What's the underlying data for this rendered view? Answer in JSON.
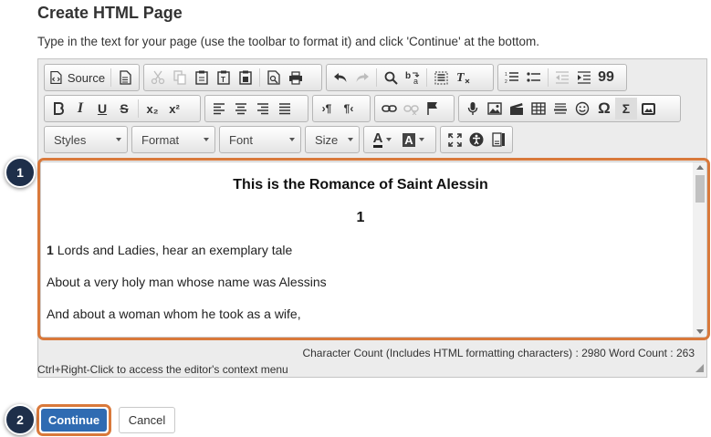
{
  "page": {
    "title": "Create HTML Page",
    "instructions": "Type in the text for your page (use the toolbar to format it) and click 'Continue' at the bottom."
  },
  "toolbar": {
    "source_label": "Source",
    "styles_label": "Styles",
    "format_label": "Format",
    "font_label": "Font",
    "size_label": "Size",
    "icons": {
      "italic": "I",
      "underline": "U",
      "strike": "S",
      "subscript": "x₂",
      "superscript": "x²",
      "ltr": "›¶",
      "rtl": "¶‹",
      "quote": "99",
      "omega": "Ω",
      "sigma": "Σ",
      "text_color": "A",
      "bg_color": "A"
    }
  },
  "editor": {
    "heading": "This is the Romance of Saint Alessin",
    "subheading": "1",
    "line1_number": "1",
    "line1_text": "Lords and Ladies, hear an exemplary tale",
    "line2": "About a very holy man whose name was Alessins",
    "line3": "And about a woman whom he took as a wife,"
  },
  "status": {
    "word_count": "Character Count (Includes HTML formatting characters) : 2980 Word Count : 263",
    "hint": "Ctrl+Right-Click to access the editor's context menu"
  },
  "buttons": {
    "continue": "Continue",
    "cancel": "Cancel"
  },
  "badges": {
    "b1": "1",
    "b2": "2"
  },
  "colors": {
    "accent_orange": "#d9793b",
    "primary_blue": "#2f6bb2",
    "badge_navy": "#1e2f4a"
  }
}
